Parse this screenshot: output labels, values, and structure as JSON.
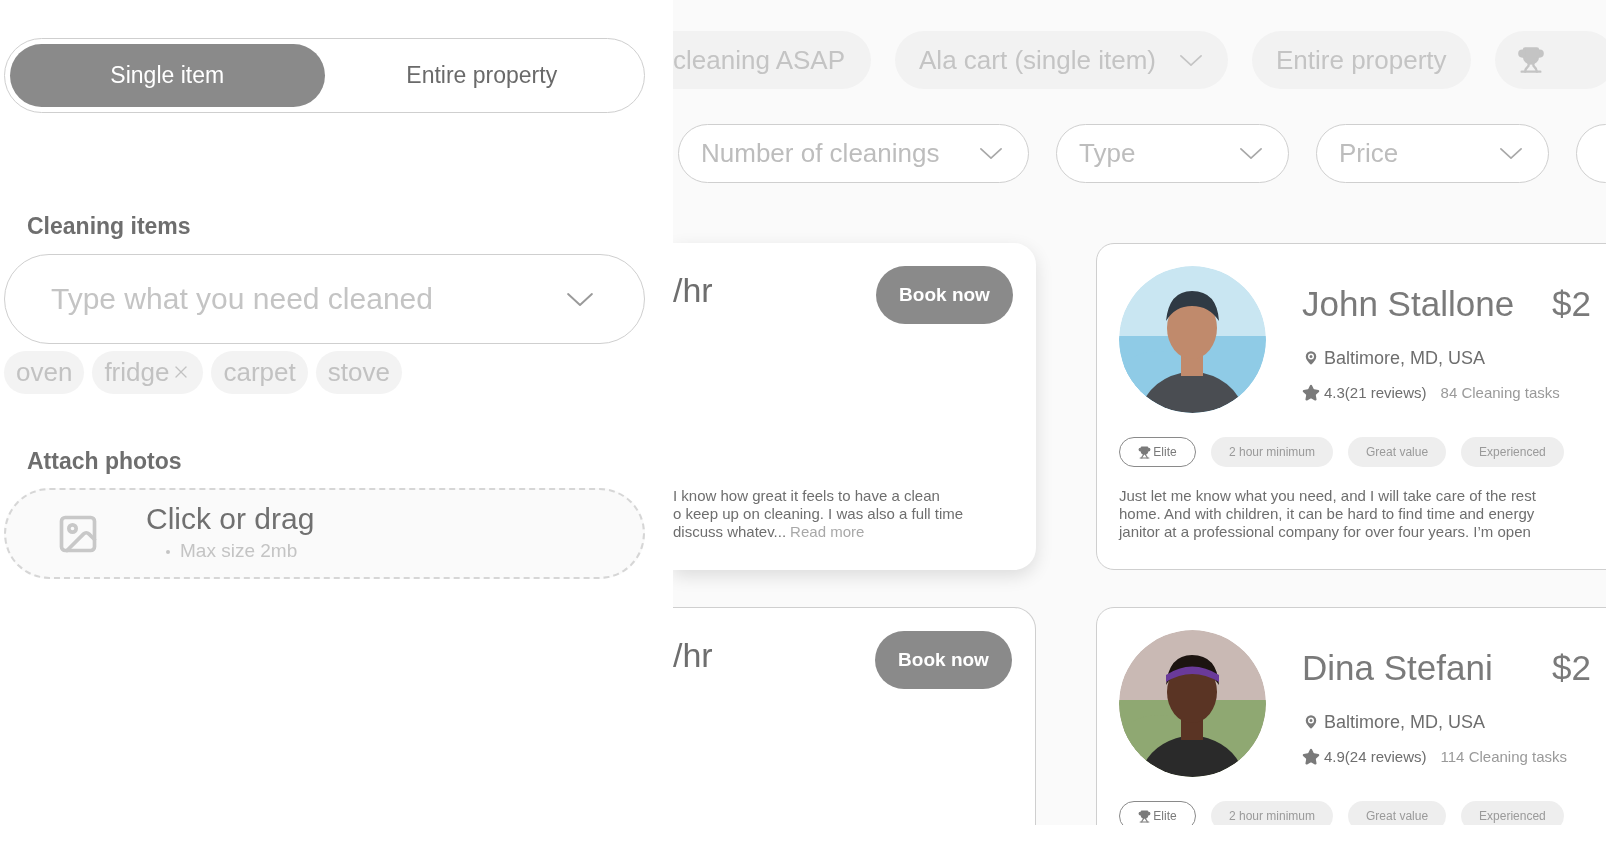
{
  "scope_toggle": [
    {
      "label": "Single item",
      "selected": true
    },
    {
      "label": "Entire property",
      "selected": false
    }
  ],
  "cleaning_items": {
    "label": "Cleaning items",
    "placeholder": "Type what you need cleaned",
    "tags": [
      {
        "label": "oven",
        "removable": false
      },
      {
        "label": "fridge",
        "removable": true
      },
      {
        "label": "carpet",
        "removable": false
      },
      {
        "label": "stove",
        "removable": false
      }
    ]
  },
  "attach_photos": {
    "label": "Attach photos",
    "title": "Click or drag",
    "hint": "Max size 2mb"
  },
  "quick_filters": [
    {
      "kind": "plain",
      "label": "cleaning ASAP"
    },
    {
      "kind": "dropdown",
      "label": "Ala cart (single item)"
    },
    {
      "kind": "plain",
      "label": "Entire property"
    },
    {
      "kind": "trophy"
    }
  ],
  "filters": [
    {
      "kind": "dropdown",
      "label": "Number of cleanings"
    },
    {
      "kind": "dropdown",
      "label": "Type"
    },
    {
      "kind": "dropdown",
      "label": "Price"
    },
    {
      "kind": "blank"
    }
  ],
  "rate_cards": [
    {
      "elevated": true,
      "rate": "/hr",
      "button": "Book now",
      "description_lines": [
        "I know how great it feels to have a clean",
        "o keep up on cleaning. I was also a full time",
        "discuss whatev..."
      ],
      "read_more": "Read more"
    },
    {
      "elevated": false,
      "rate": "/hr",
      "button": "Book now"
    }
  ],
  "cleaners": [
    {
      "name": "John Stallone",
      "price": "$2",
      "location": "Baltimore, MD, USA",
      "rating": "4.3(21 reviews)",
      "tasks": "84 Cleaning tasks",
      "badges": [
        {
          "kind": "award",
          "label": "Elite"
        },
        {
          "kind": "tag",
          "label": "2 hour minimum"
        },
        {
          "kind": "tag",
          "label": "Great value"
        },
        {
          "kind": "tag",
          "label": "Experienced"
        }
      ],
      "bio_lines": [
        "Just let me know what you need, and I will take care of the rest",
        "home. And with children, it can be hard to find time and energy",
        "janitor at a professional company for over four years. I’m open"
      ]
    },
    {
      "name": "Dina Stefani",
      "price": "$2",
      "location": "Baltimore, MD, USA",
      "rating": "4.9(24 reviews)",
      "tasks": "114 Cleaning tasks",
      "badges": [
        {
          "kind": "award",
          "label": "Elite"
        },
        {
          "kind": "tag",
          "label": "2 hour minimum"
        },
        {
          "kind": "tag",
          "label": "Great value"
        },
        {
          "kind": "tag",
          "label": "Experienced"
        }
      ]
    }
  ]
}
